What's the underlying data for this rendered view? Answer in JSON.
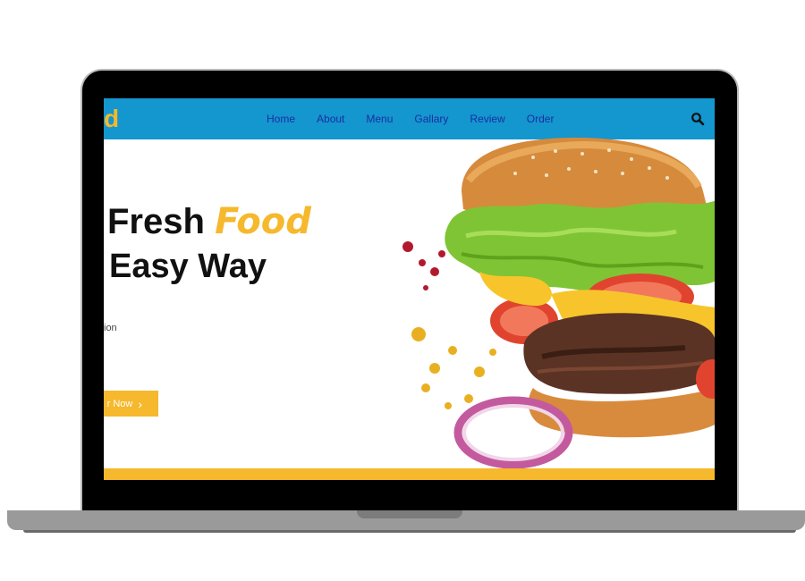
{
  "brand": {
    "logo_text": "d"
  },
  "nav": {
    "items": [
      {
        "label": "Home"
      },
      {
        "label": "About"
      },
      {
        "label": "Menu"
      },
      {
        "label": "Gallary"
      },
      {
        "label": "Review"
      },
      {
        "label": "Order"
      }
    ]
  },
  "hero": {
    "line1": "Fresh",
    "line1_accent": "Food",
    "line2": "Easy Way",
    "subtitle": "ion",
    "button_label": "r Now",
    "button_icon": "chevron-right-icon"
  },
  "colors": {
    "nav_bg": "#1496cf",
    "accent": "#f6b82c",
    "nav_link": "#1a2fa0"
  },
  "icons": [
    "search-icon",
    "chevron-right-icon"
  ]
}
